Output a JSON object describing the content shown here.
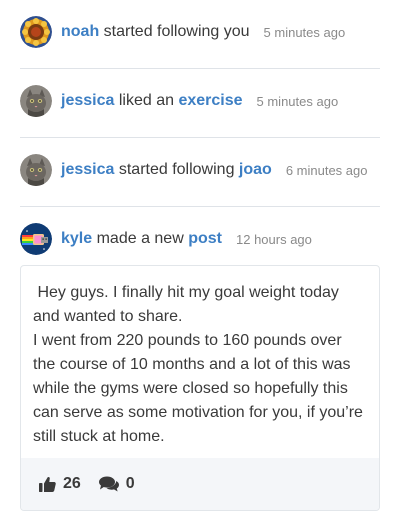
{
  "notifications": [
    {
      "actor": "noah",
      "action": "started following you",
      "target": "",
      "time": "5 minutes ago",
      "avatar_icon": "sunflower-avatar"
    },
    {
      "actor": "jessica",
      "action": "liked an",
      "target": "exercise",
      "time": "5 minutes ago",
      "avatar_icon": "cat-avatar"
    },
    {
      "actor": "jessica",
      "action": "started following",
      "target": "joao",
      "time": "6 minutes ago",
      "avatar_icon": "cat-avatar"
    },
    {
      "actor": "kyle",
      "action": "made a new",
      "target": "post",
      "time": "12 hours ago",
      "avatar_icon": "nyan-cat-avatar"
    }
  ],
  "post": {
    "paragraphs": [
      " Hey guys. I finally hit my goal weight today and wanted to share.",
      "I went from 220 pounds to 160 pounds over the course of 10 months and a lot of this was while the gyms were closed so hopefully this can serve as some motivation for you, if you’re still stuck at home."
    ],
    "likes": "26",
    "comments": "0"
  },
  "colors": {
    "link": "#3d7fc4",
    "text": "#3a3a3a",
    "muted": "#8a8a8a",
    "divider": "#dfe3e8",
    "footer_bg": "#f4f6f9"
  }
}
